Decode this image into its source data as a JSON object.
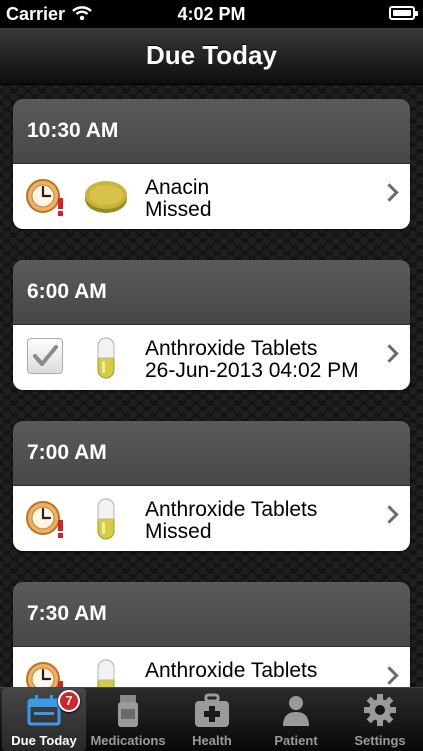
{
  "status_bar": {
    "carrier": "Carrier",
    "time": "4:02 PM"
  },
  "nav": {
    "title": "Due Today"
  },
  "doses": [
    {
      "time": "10:30 AM",
      "medication": "Anacin",
      "status": "Missed",
      "status_icon": "missed-clock-icon",
      "med_icon": "tablet-icon"
    },
    {
      "time": "6:00 AM",
      "medication": "Anthroxide Tablets",
      "status": "26-Jun-2013 04:02 PM",
      "status_icon": "checkbox-checked-icon",
      "med_icon": "capsule-icon"
    },
    {
      "time": "7:00 AM",
      "medication": "Anthroxide Tablets",
      "status": "Missed",
      "status_icon": "missed-clock-icon",
      "med_icon": "capsule-icon"
    },
    {
      "time": "7:30 AM",
      "medication": "Anthroxide Tablets",
      "status": "",
      "status_icon": "missed-clock-icon",
      "med_icon": "capsule-icon"
    }
  ],
  "tabs": [
    {
      "label": "Due Today",
      "icon": "calendar-icon",
      "badge": "7",
      "active": true
    },
    {
      "label": "Medications",
      "icon": "pill-bottle-icon",
      "active": false
    },
    {
      "label": "Health",
      "icon": "first-aid-kit-icon",
      "active": false
    },
    {
      "label": "Patient",
      "icon": "person-icon",
      "active": false
    },
    {
      "label": "Settings",
      "icon": "gear-icon",
      "active": false
    }
  ],
  "colors": {
    "missed_icon_orange": "#f0b060",
    "alert_red": "#d2232a",
    "tablet_yellow": "#c8b43a",
    "capsule_yellow": "#d6cc40"
  }
}
